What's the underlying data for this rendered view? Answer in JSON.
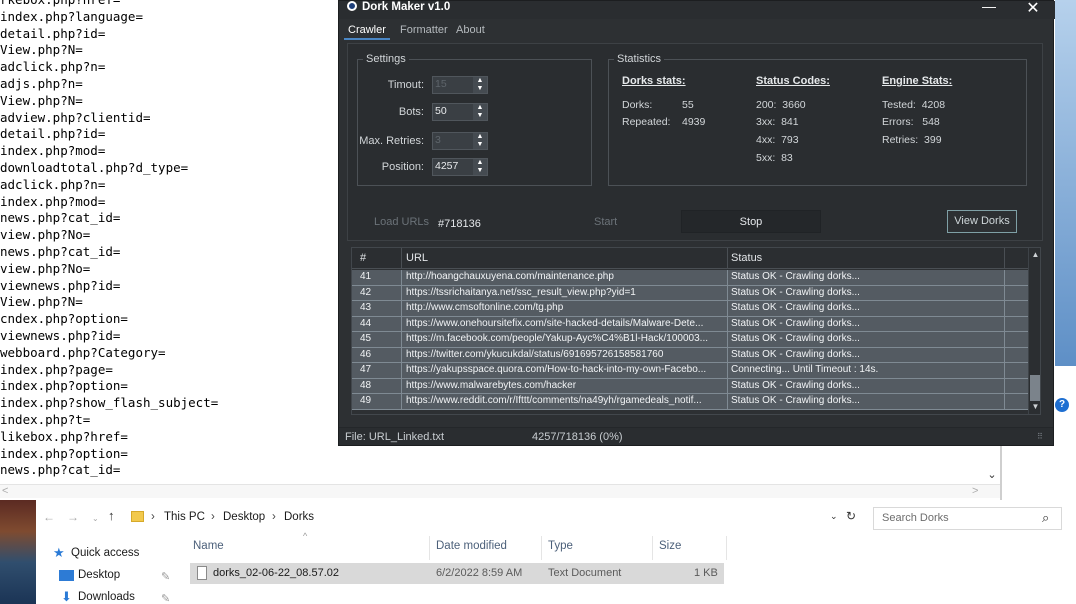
{
  "editor": {
    "lines": [
      "rkebox.php?href=",
      "index.php?language=",
      "detail.php?id=",
      "View.php?N=",
      "adclick.php?n=",
      "adjs.php?n=",
      "View.php?N=",
      "adview.php?clientid=",
      "detail.php?id=",
      "index.php?mod=",
      "downloadtotal.php?d_type=",
      "adclick.php?n=",
      "index.php?mod=",
      "news.php?cat_id=",
      "view.php?No=",
      "news.php?cat_id=",
      "view.php?No=",
      "viewnews.php?id=",
      "View.php?N=",
      "cndex.php?option=",
      "viewnews.php?id=",
      "webboard.php?Category=",
      "index.php?page=",
      "index.php?option=",
      "index.php?show_flash_subject=",
      "index.php?t=",
      "likebox.php?href=",
      "index.php?option=",
      "news.php?cat_id="
    ],
    "scroll_down": "⌄",
    "scroll_left": "<",
    "scroll_right": ">"
  },
  "app": {
    "title": "Dork Maker v1.0",
    "minimize": "—",
    "close": "✕",
    "tabs": [
      "Crawler",
      "Formatter",
      "About"
    ],
    "settings": {
      "legend": "Settings",
      "timeout_label": "Timout:",
      "timeout_value": "15",
      "bots_label": "Bots:",
      "bots_value": "50",
      "retries_label": "Max. Retries:",
      "retries_value": "3",
      "position_label": "Position:",
      "position_value": "4257"
    },
    "statistics": {
      "legend": "Statistics",
      "dorks_header": "Dorks stats:",
      "dorks_label": "Dorks:",
      "dorks_value": "55",
      "repeated_label": "Repeated:",
      "repeated_value": "4939",
      "status_header": "Status Codes:",
      "s200": "200:  3660",
      "s3xx": "3xx:  841",
      "s4xx": "4xx:  793",
      "s5xx": "5xx:  83",
      "engine_header": "Engine Stats:",
      "tested": "Tested:  4208",
      "errors": "Errors:   548",
      "retries": "Retries:  399"
    },
    "controls": {
      "load_urls": "Load URLs",
      "url_count": "#718136",
      "start": "Start",
      "stop": "Stop",
      "view_dorks": "View Dorks"
    },
    "grid": {
      "headers": [
        "#",
        "URL",
        "Status"
      ],
      "rows": [
        {
          "n": "41",
          "url": "http://hoangchauxuyena.com/maintenance.php",
          "status": "Status OK - Crawling dorks..."
        },
        {
          "n": "42",
          "url": "https://tssrichaitanya.net/ssc_result_view.php?yid=1",
          "status": "Status OK - Crawling dorks..."
        },
        {
          "n": "43",
          "url": "http://www.cmsoftonline.com/tg.php",
          "status": "Status OK - Crawling dorks..."
        },
        {
          "n": "44",
          "url": "https://www.onehoursitefix.com/site-hacked-details/Malware-Dete...",
          "status": "Status OK - Crawling dorks..."
        },
        {
          "n": "45",
          "url": "https://m.facebook.com/people/Yakup-Ayc%C4%B1l-Hack/100003...",
          "status": "Status OK - Crawling dorks..."
        },
        {
          "n": "46",
          "url": "https://twitter.com/ykucukdal/status/691695726158581760",
          "status": "Status OK - Crawling dorks..."
        },
        {
          "n": "47",
          "url": "https://yakupsspace.quora.com/How-to-hack-into-my-own-Facebo...",
          "status": "Connecting... Until Timeout : 14s."
        },
        {
          "n": "48",
          "url": "https://www.malwarebytes.com/hacker",
          "status": "Status OK - Crawling dorks..."
        },
        {
          "n": "49",
          "url": "https://www.reddit.com/r/Ifttt/comments/na49yh/rgamedeals_notif...",
          "status": "Status OK - Crawling dorks..."
        }
      ],
      "scroll_up": "▲",
      "scroll_down": "▼"
    },
    "status_file": "File: URL_Linked.txt",
    "status_progress": "4257/718136 (0%)",
    "grip": "⠿"
  },
  "explorer": {
    "back": "←",
    "forward": "→",
    "recent": "⌄",
    "up": "↑",
    "crumb_arrow": "›",
    "crumbs": [
      "This PC",
      "Desktop",
      "Dorks"
    ],
    "addr_dropdown": "⌄",
    "refresh": "↻",
    "search_placeholder": "Search Dorks",
    "search_icon": "⌕",
    "sort_arrow": "^",
    "columns": [
      "Name",
      "Date modified",
      "Type",
      "Size"
    ],
    "file": {
      "name": "dorks_02-06-22_08.57.02",
      "date": "6/2/2022 8:59 AM",
      "type": "Text Document",
      "size": "1 KB"
    },
    "nav": {
      "quick_access": "Quick access",
      "desktop": "Desktop",
      "downloads": "Downloads",
      "star": "★",
      "download_glyph": "⬇",
      "pin": "✎"
    }
  },
  "help_glyph": "?",
  "colors": {
    "app_bg": "#2d3033",
    "grid_row": "#545b62",
    "accent": "#4a86c4",
    "file_row_selected": "#d9d9d9"
  }
}
